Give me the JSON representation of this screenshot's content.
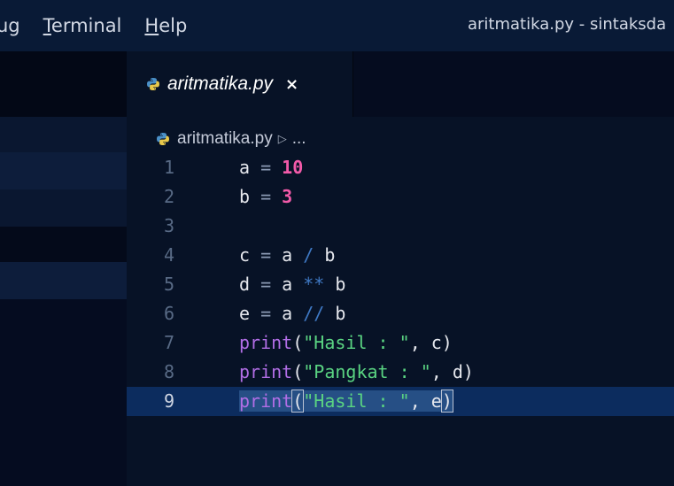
{
  "menubar": {
    "items": [
      {
        "mnemonic": "",
        "rest": "ug"
      },
      {
        "mnemonic": "T",
        "rest": "erminal"
      },
      {
        "mnemonic": "H",
        "rest": "elp"
      }
    ],
    "window_title": "aritmatika.py - sintaksda"
  },
  "colors": {
    "menubar_bg": "#091a36",
    "editor_bg": "#071226",
    "current_line_bg": "#0c2c5e",
    "keyword_purple": "#b26ee6",
    "string_green": "#5ad482",
    "number_pink": "#f25aa9",
    "operator_blue": "#3f79c4"
  },
  "tab": {
    "icon": "python-file-icon",
    "label": "aritmatika.py",
    "close": "×"
  },
  "breadcrumb": {
    "icon": "python-file-icon",
    "file": "aritmatika.py",
    "separator": "▷",
    "more": "..."
  },
  "code": {
    "current_line": 9,
    "lines": [
      {
        "n": "1",
        "tokens": [
          [
            "var",
            "a"
          ],
          [
            "eq",
            " = "
          ],
          [
            "num",
            "10"
          ]
        ]
      },
      {
        "n": "2",
        "tokens": [
          [
            "var",
            "b"
          ],
          [
            "eq",
            " = "
          ],
          [
            "num",
            "3"
          ]
        ]
      },
      {
        "n": "3",
        "tokens": []
      },
      {
        "n": "4",
        "tokens": [
          [
            "var",
            "c"
          ],
          [
            "eq",
            " = "
          ],
          [
            "var",
            "a"
          ],
          [
            "op",
            " / "
          ],
          [
            "var",
            "b"
          ]
        ]
      },
      {
        "n": "5",
        "tokens": [
          [
            "var",
            "d"
          ],
          [
            "eq",
            " = "
          ],
          [
            "var",
            "a"
          ],
          [
            "op",
            " ** "
          ],
          [
            "var",
            "b"
          ]
        ]
      },
      {
        "n": "6",
        "tokens": [
          [
            "var",
            "e"
          ],
          [
            "eq",
            " = "
          ],
          [
            "var",
            "a"
          ],
          [
            "op",
            " // "
          ],
          [
            "var",
            "b"
          ]
        ]
      },
      {
        "n": "7",
        "tokens": [
          [
            "fn",
            "print"
          ],
          [
            "punc",
            "("
          ],
          [
            "str",
            "\"Hasil : \""
          ],
          [
            "punc",
            ", c)"
          ]
        ]
      },
      {
        "n": "8",
        "tokens": [
          [
            "fn",
            "print"
          ],
          [
            "punc",
            "("
          ],
          [
            "str",
            "\"Pangkat : \""
          ],
          [
            "punc",
            ", d)"
          ]
        ]
      },
      {
        "n": "9",
        "tokens": [
          [
            "fn",
            "print"
          ],
          [
            "bracket",
            "("
          ],
          [
            "str",
            "\"Hasil : \""
          ],
          [
            "punc",
            ", e"
          ],
          [
            "bracket",
            ")"
          ]
        ]
      }
    ]
  }
}
